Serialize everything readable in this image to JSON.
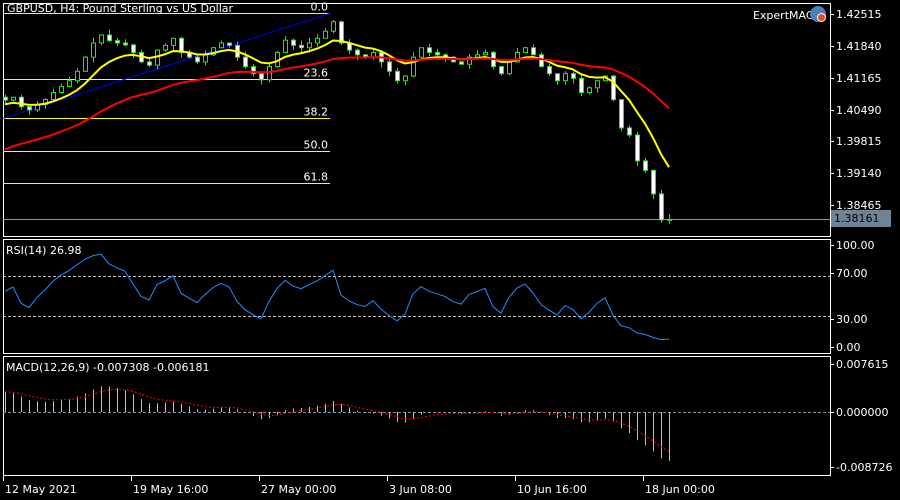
{
  "header": {
    "title": "GBPUSD, H4:  Pound Sterling vs US Dollar",
    "expert": "ExpertMACD"
  },
  "current_price": "1.38161",
  "colors": {
    "bull": "#00ff00",
    "bear_body": "#ffffff",
    "ma_fast": "#ffff00",
    "ma_slow": "#ff0000",
    "trend": "#0000ff",
    "fib": "#ffff00",
    "rsi": "#1e90ff",
    "macd_hist": "#c0c0c0",
    "macd_signal": "#ff0000"
  },
  "chart_data": [
    {
      "type": "candlestick",
      "title": "GBPUSD, H4",
      "yticks": [
        "1.42515",
        "1.41840",
        "1.41165",
        "1.40490",
        "1.39815",
        "1.39140",
        "1.38465"
      ],
      "ylim": [
        1.3785,
        1.4275
      ],
      "closes": [
        1.4069,
        1.4075,
        1.4055,
        1.4048,
        1.406,
        1.407,
        1.4085,
        1.4098,
        1.411,
        1.413,
        1.416,
        1.419,
        1.4207,
        1.4195,
        1.419,
        1.4186,
        1.417,
        1.415,
        1.4143,
        1.4175,
        1.4185,
        1.42,
        1.417,
        1.416,
        1.415,
        1.4165,
        1.418,
        1.419,
        1.4185,
        1.416,
        1.414,
        1.4125,
        1.4112,
        1.414,
        1.417,
        1.4196,
        1.4185,
        1.418,
        1.419,
        1.42,
        1.4215,
        1.4235,
        1.419,
        1.4175,
        1.4165,
        1.416,
        1.417,
        1.415,
        1.413,
        1.411,
        1.412,
        1.416,
        1.418,
        1.417,
        1.4165,
        1.416,
        1.415,
        1.4145,
        1.416,
        1.4165,
        1.417,
        1.414,
        1.4125,
        1.415,
        1.417,
        1.418,
        1.4165,
        1.414,
        1.4125,
        1.411,
        1.4125,
        1.4115,
        1.4085,
        1.4095,
        1.411,
        1.412,
        1.407,
        1.401,
        1.3995,
        1.394,
        1.392,
        1.387,
        1.3815,
        1.3816
      ],
      "ma_fast_seed": 1.4058,
      "ma_slow_seed": 1.3958,
      "fib_levels": [
        {
          "label": "0.0",
          "price": 1.4253
        },
        {
          "label": "23.6",
          "price": 1.4114
        },
        {
          "label": "38.2",
          "price": 1.403
        },
        {
          "label": "50.0",
          "price": 1.396
        },
        {
          "label": "61.8",
          "price": 1.3893
        }
      ],
      "trendline": {
        "from_price": 1.403,
        "to_price": 1.4253
      }
    },
    {
      "type": "line",
      "title": "RSI(14) 26.98",
      "yticks": [
        "100.00",
        "70.00",
        "30.00",
        "0.00"
      ],
      "levels": [
        70,
        30
      ],
      "ylim": [
        0,
        100
      ]
    },
    {
      "type": "bar",
      "title": "MACD(12,26,9) -0.007308 -0.006181",
      "yticks": [
        "0.007615",
        "0.000000",
        "-0.008726"
      ],
      "ylim": [
        -0.008726,
        0.007615
      ]
    }
  ],
  "xticks": [
    "12 May 2021",
    "19 May 16:00",
    "27 May 00:00",
    "3 Jun 08:00",
    "10 Jun 16:00",
    "18 Jun 00:00"
  ]
}
